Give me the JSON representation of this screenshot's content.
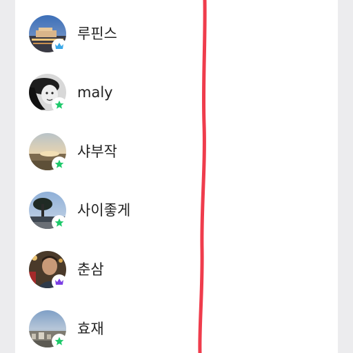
{
  "colors": {
    "page_background": "#ececee",
    "panel_background": "#ffffff",
    "text": "#222222",
    "badge_star_green": "#1ec96b",
    "badge_crown_blue": "#3aa8e8",
    "badge_crown_purple": "#7b3fe4",
    "annotation_line": "#ee2b3d"
  },
  "annotation": {
    "icon": "red-pen-vertical-stroke"
  },
  "users": [
    {
      "nickname": "루핀스",
      "badge_icon": "crown-icon",
      "badge_color": "#3aa8e8",
      "avatar_icon": "city-night-photo"
    },
    {
      "nickname": "maly",
      "badge_icon": "star-icon",
      "badge_color": "#1ec96b",
      "avatar_icon": "woman-bw-portrait-photo"
    },
    {
      "nickname": "샤부작",
      "badge_icon": "star-icon",
      "badge_color": "#1ec96b",
      "avatar_icon": "sunset-landscape-photo"
    },
    {
      "nickname": "사이좋게",
      "badge_icon": "star-icon",
      "badge_color": "#1ec96b",
      "avatar_icon": "tree-dusk-photo"
    },
    {
      "nickname": "춘삼",
      "badge_icon": "crown-icon",
      "badge_color": "#7b3fe4",
      "avatar_icon": "man-portrait-photo"
    },
    {
      "nickname": "효재",
      "badge_icon": "star-icon",
      "badge_color": "#1ec96b",
      "avatar_icon": "cityscape-sky-photo"
    }
  ]
}
